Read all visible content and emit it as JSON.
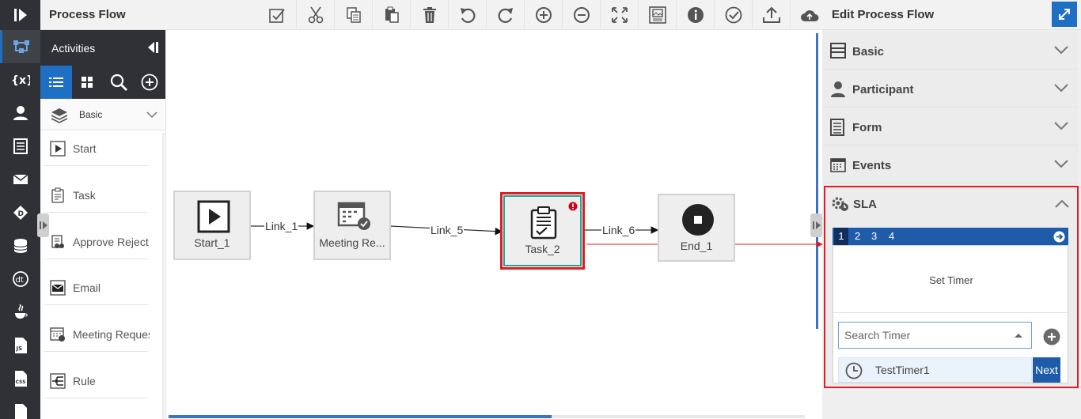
{
  "app": {
    "title": "Process Flow",
    "toolbar": [
      "validate",
      "cut",
      "copy",
      "paste",
      "delete",
      "undo",
      "redo",
      "zoom-in",
      "zoom-out",
      "fit-screen",
      "save-image",
      "info",
      "check",
      "upload",
      "cloud-upload"
    ]
  },
  "rail": [
    "process-flow-icon",
    "variables-icon",
    "participant-icon",
    "form-icon",
    "email-icon",
    "decision-icon",
    "database-icon",
    "dt-icon",
    "java-icon",
    "js-icon",
    "css-icon",
    "page-icon"
  ],
  "activities": {
    "title": "Activities",
    "category": "Basic",
    "items": [
      {
        "label": "Start",
        "icon": "start-icon"
      },
      {
        "label": "Task",
        "icon": "task-icon"
      },
      {
        "label": "Approve Reject",
        "icon": "approve-reject-icon"
      },
      {
        "label": "Email",
        "icon": "email-icon"
      },
      {
        "label": "Meeting Request",
        "icon": "meeting-request-icon"
      },
      {
        "label": "Rule",
        "icon": "rule-icon"
      }
    ]
  },
  "canvas": {
    "nodes": [
      {
        "id": "start",
        "label": "Start_1"
      },
      {
        "id": "meeting",
        "label": "Meeting Re..."
      },
      {
        "id": "task",
        "label": "Task_2"
      },
      {
        "id": "end",
        "label": "End_1"
      }
    ],
    "links": [
      "Link_1",
      "Link_5",
      "Link_6"
    ]
  },
  "right_panel": {
    "title": "Edit Process Flow",
    "sections": [
      {
        "label": "Basic",
        "icon": "basic-icon"
      },
      {
        "label": "Participant",
        "icon": "participant-icon"
      },
      {
        "label": "Form",
        "icon": "form-icon"
      },
      {
        "label": "Events",
        "icon": "events-icon"
      }
    ],
    "sla": {
      "label": "SLA",
      "tabs": [
        "1",
        "2",
        "3",
        "4"
      ],
      "active_tab": "1",
      "set_timer": "Set Timer",
      "search_placeholder": "Search Timer",
      "timers": [
        "TestTimer1"
      ],
      "next_label": "Next"
    }
  },
  "colors": {
    "accent": "#1f6fc4",
    "highlight": "#e31b23",
    "selected_border": "#1aa89a",
    "rail": "#2f3136"
  }
}
